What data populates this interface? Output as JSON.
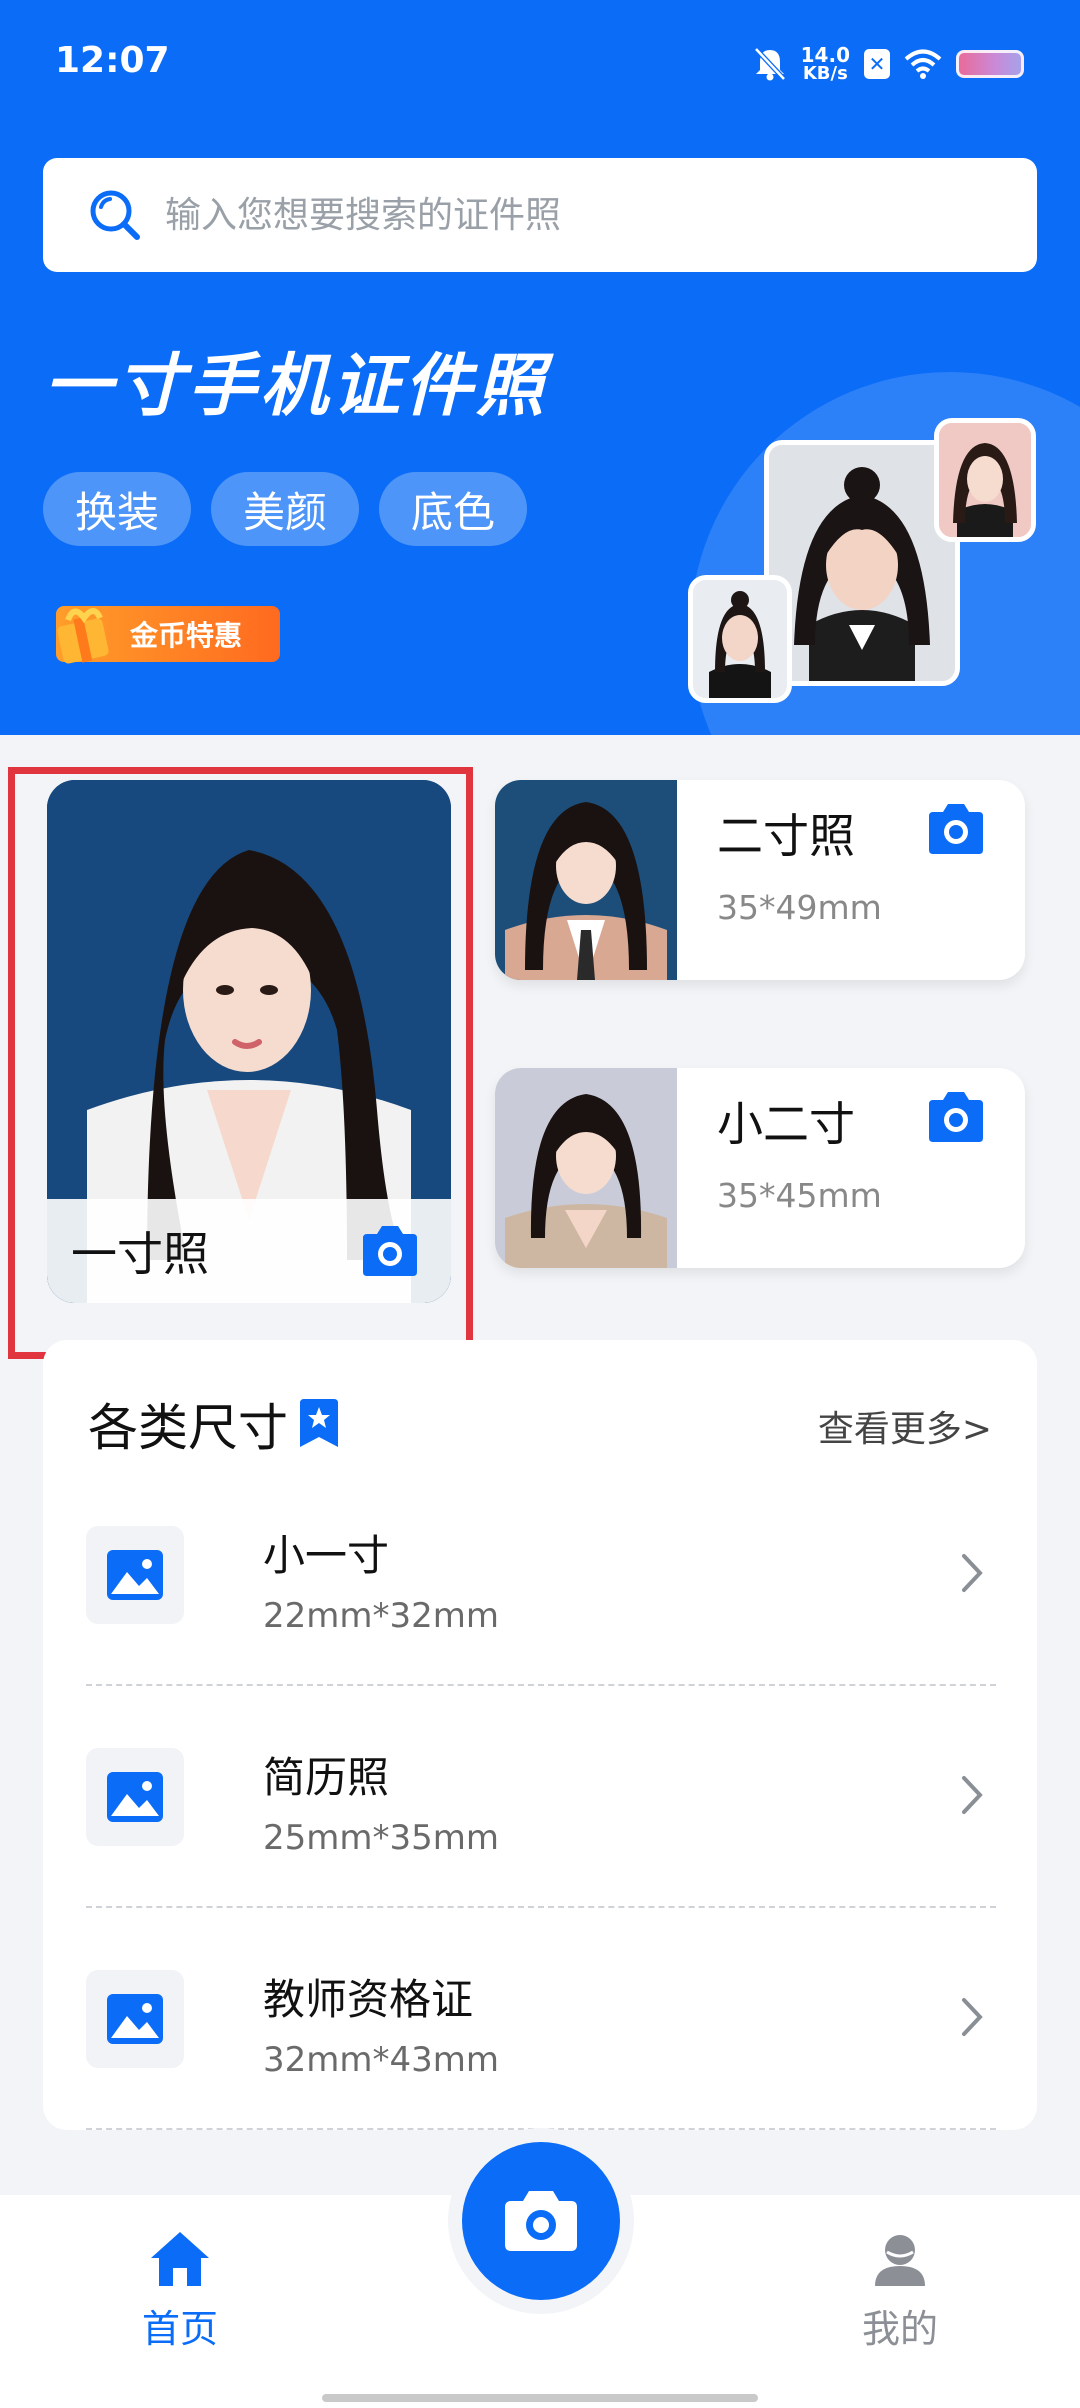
{
  "status": {
    "time": "12:07",
    "speed_value": "14.0",
    "speed_unit": "KB/s"
  },
  "search": {
    "placeholder": "输入您想要搜索的证件照"
  },
  "hero": {
    "title": "一寸手机证件照",
    "tags": [
      "换装",
      "美颜",
      "底色"
    ],
    "coin_badge": "金币特惠"
  },
  "cards": {
    "main": {
      "label": "一寸照"
    },
    "side": [
      {
        "title": "二寸照",
        "size": "35*49mm"
      },
      {
        "title": "小二寸",
        "size": "35*45mm"
      }
    ]
  },
  "sizes": {
    "title": "各类尺寸",
    "more": "查看更多>",
    "items": [
      {
        "name": "小一寸",
        "dim": "22mm*32mm"
      },
      {
        "name": "简历照",
        "dim": "25mm*35mm"
      },
      {
        "name": "教师资格证",
        "dim": "32mm*43mm"
      }
    ]
  },
  "nav": {
    "home": "首页",
    "mine": "我的"
  },
  "colors": {
    "primary": "#0a6cf7",
    "highlight": "#e0353f",
    "background": "#f2f4f7"
  }
}
